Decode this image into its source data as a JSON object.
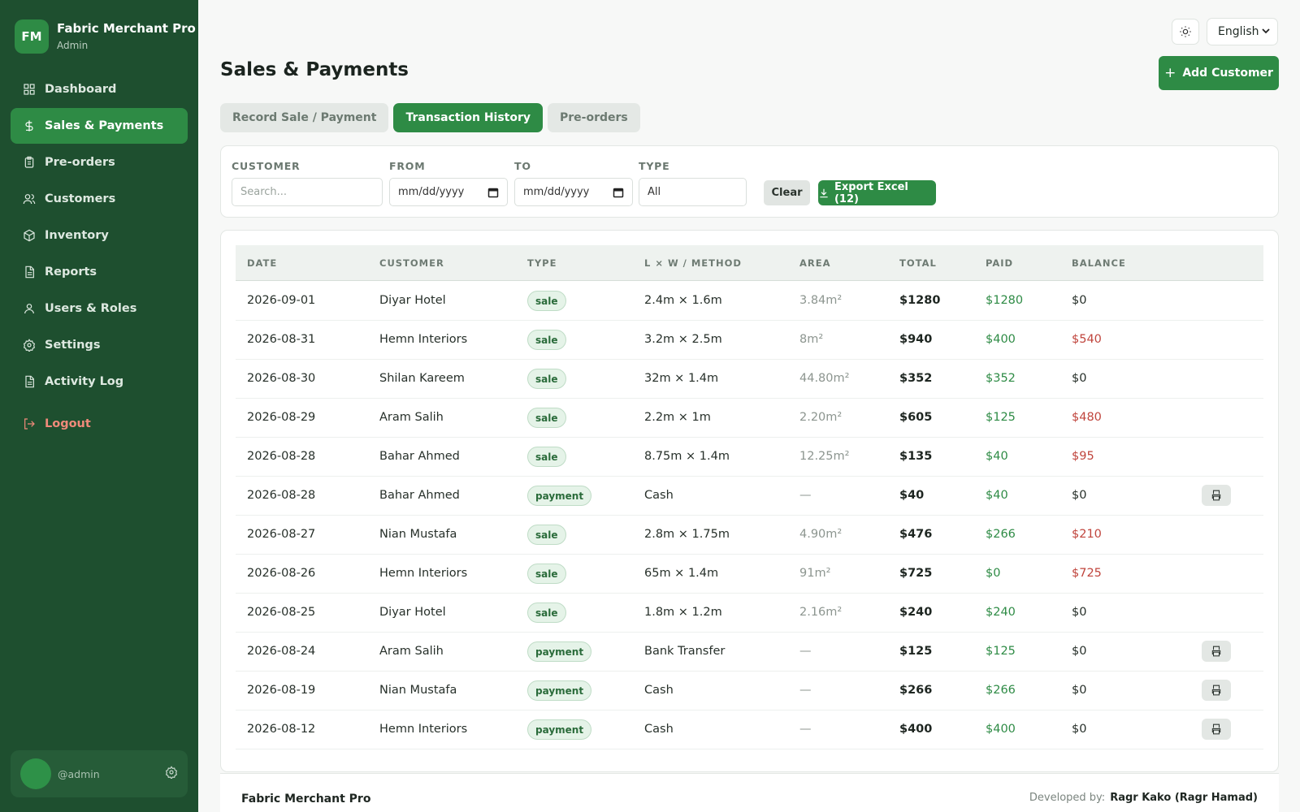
{
  "brand": {
    "logo": "FM",
    "name": "Fabric Merchant Pro",
    "role": "Admin"
  },
  "nav": [
    {
      "label": "Dashboard",
      "icon": "dashboard-icon",
      "active": false
    },
    {
      "label": "Sales & Payments",
      "icon": "dollar-icon",
      "active": true
    },
    {
      "label": "Pre-orders",
      "icon": "clipboard-icon",
      "active": false
    },
    {
      "label": "Customers",
      "icon": "users-icon",
      "active": false
    },
    {
      "label": "Inventory",
      "icon": "box-icon",
      "active": false
    },
    {
      "label": "Reports",
      "icon": "document-icon",
      "active": false
    },
    {
      "label": "Users & Roles",
      "icon": "user-icon",
      "active": false
    },
    {
      "label": "Settings",
      "icon": "gear-icon",
      "active": false
    },
    {
      "label": "Activity Log",
      "icon": "document-icon",
      "active": false
    }
  ],
  "logout_label": "Logout",
  "user": {
    "handle": "@admin"
  },
  "topbar": {
    "language": "English"
  },
  "page": {
    "title": "Sales & Payments",
    "add_button": "Add Customer"
  },
  "tabs": [
    "Record Sale / Payment",
    "Transaction History",
    "Pre-orders"
  ],
  "active_tab": 1,
  "filters": {
    "customer_label": "CUSTOMER",
    "customer_placeholder": "Search...",
    "from_label": "FROM",
    "from_value": "mm/dd/yyyy",
    "to_label": "TO",
    "to_value": "mm/dd/yyyy",
    "type_label": "TYPE",
    "type_value": "All",
    "clear_label": "Clear",
    "export_label": "Export Excel (12)"
  },
  "table": {
    "headers": [
      "DATE",
      "CUSTOMER",
      "TYPE",
      "L × W / METHOD",
      "AREA",
      "TOTAL",
      "PAID",
      "BALANCE"
    ],
    "rows": [
      {
        "date": "2026-09-01",
        "customer": "Diyar Hotel",
        "type": "sale",
        "method": "2.4m × 1.6m",
        "area": "3.84m²",
        "total": "$1280",
        "paid": "$1280",
        "balance": "$0",
        "owing": false,
        "print": false
      },
      {
        "date": "2026-08-31",
        "customer": "Hemn Interiors",
        "type": "sale",
        "method": "3.2m × 2.5m",
        "area": "8m²",
        "total": "$940",
        "paid": "$400",
        "balance": "$540",
        "owing": true,
        "print": false
      },
      {
        "date": "2026-08-30",
        "customer": "Shilan Kareem",
        "type": "sale",
        "method": "32m × 1.4m",
        "area": "44.80m²",
        "total": "$352",
        "paid": "$352",
        "balance": "$0",
        "owing": false,
        "print": false
      },
      {
        "date": "2026-08-29",
        "customer": "Aram Salih",
        "type": "sale",
        "method": "2.2m × 1m",
        "area": "2.20m²",
        "total": "$605",
        "paid": "$125",
        "balance": "$480",
        "owing": true,
        "print": false
      },
      {
        "date": "2026-08-28",
        "customer": "Bahar Ahmed",
        "type": "sale",
        "method": "8.75m × 1.4m",
        "area": "12.25m²",
        "total": "$135",
        "paid": "$40",
        "balance": "$95",
        "owing": true,
        "print": false
      },
      {
        "date": "2026-08-28",
        "customer": "Bahar Ahmed",
        "type": "payment",
        "method": "Cash",
        "area": "—",
        "total": "$40",
        "paid": "$40",
        "balance": "$0",
        "owing": false,
        "print": true
      },
      {
        "date": "2026-08-27",
        "customer": "Nian Mustafa",
        "type": "sale",
        "method": "2.8m × 1.75m",
        "area": "4.90m²",
        "total": "$476",
        "paid": "$266",
        "balance": "$210",
        "owing": true,
        "print": false
      },
      {
        "date": "2026-08-26",
        "customer": "Hemn Interiors",
        "type": "sale",
        "method": "65m × 1.4m",
        "area": "91m²",
        "total": "$725",
        "paid": "$0",
        "balance": "$725",
        "owing": true,
        "print": false
      },
      {
        "date": "2026-08-25",
        "customer": "Diyar Hotel",
        "type": "sale",
        "method": "1.8m × 1.2m",
        "area": "2.16m²",
        "total": "$240",
        "paid": "$240",
        "balance": "$0",
        "owing": false,
        "print": false
      },
      {
        "date": "2026-08-24",
        "customer": "Aram Salih",
        "type": "payment",
        "method": "Bank Transfer",
        "area": "—",
        "total": "$125",
        "paid": "$125",
        "balance": "$0",
        "owing": false,
        "print": true
      },
      {
        "date": "2026-08-19",
        "customer": "Nian Mustafa",
        "type": "payment",
        "method": "Cash",
        "area": "—",
        "total": "$266",
        "paid": "$266",
        "balance": "$0",
        "owing": false,
        "print": true
      },
      {
        "date": "2026-08-12",
        "customer": "Hemn Interiors",
        "type": "payment",
        "method": "Cash",
        "area": "—",
        "total": "$400",
        "paid": "$400",
        "balance": "$0",
        "owing": false,
        "print": true
      }
    ]
  },
  "footer": {
    "brand": "Fabric Merchant Pro",
    "dev_label": "Developed by:",
    "dev_name": "Ragr Kako (Ragr Hamad)"
  },
  "colors": {
    "sidebar": "#1e4f2f",
    "accent": "#2e8b45",
    "negative": "#c0453d"
  }
}
